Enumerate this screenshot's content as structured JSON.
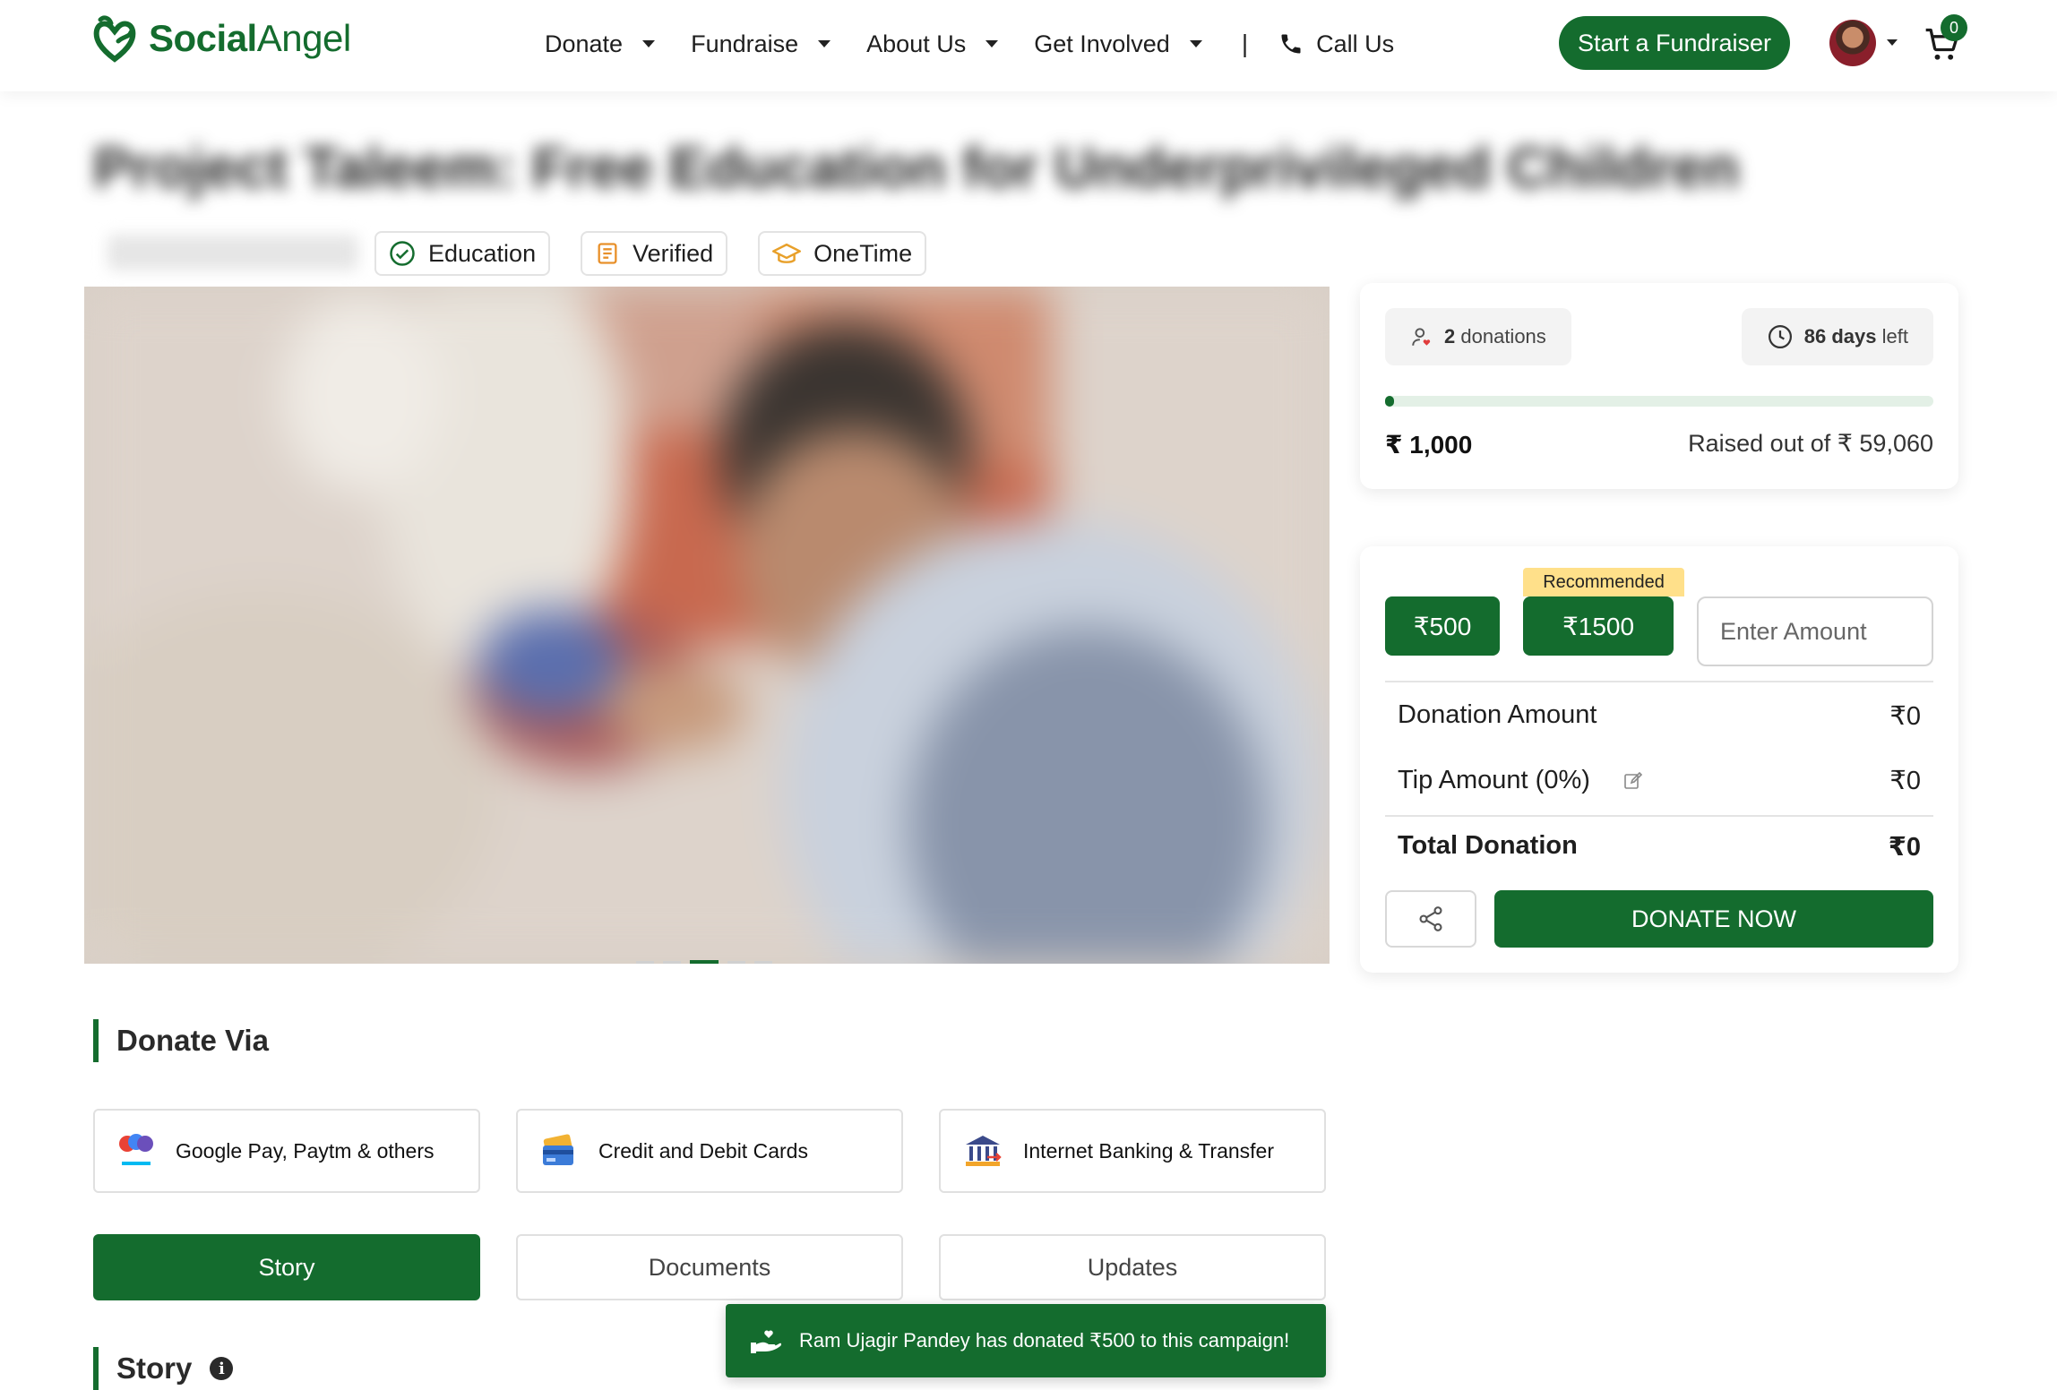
{
  "brand": {
    "logo_part1": "Social",
    "logo_part2": "Angel",
    "color": "#146c2e"
  },
  "nav": {
    "items": [
      {
        "label": "Donate"
      },
      {
        "label": "Fundraise"
      },
      {
        "label": "About Us"
      },
      {
        "label": "Get Involved"
      }
    ],
    "separator": "|",
    "call_label": "Call Us",
    "call_icon": "phone-icon",
    "start_button": "Start a Fundraiser",
    "cart_count": "0",
    "cart_icon": "cart-icon"
  },
  "campaign": {
    "title": "Project Taleem: Free Education for Underprivileged Children",
    "tags": [
      {
        "label": "Education",
        "icon": "check-circle-icon"
      },
      {
        "label": "Verified",
        "icon": "document-icon"
      },
      {
        "label": "OneTime",
        "icon": "graduation-cap-icon"
      }
    ],
    "carousel_active_index": 2
  },
  "stats": {
    "donations_count": "2",
    "donations_label": "donations",
    "days_count": "86 days",
    "days_label": "left",
    "raised": "₹ 1,000",
    "raised_out_of": "Raised out of ₹ 59,060",
    "progress_fraction": 0.017
  },
  "donate": {
    "option_1": "₹500",
    "option_2": "₹1500",
    "recommended_label": "Recommended",
    "amount_placeholder": "Enter Amount",
    "donation_amount_label": "Donation Amount",
    "donation_amount_value": "₹0",
    "tip_label": "Tip Amount (0%)",
    "tip_value": "₹0",
    "total_label": "Total Donation",
    "total_value": "₹0",
    "donate_button": "DONATE NOW"
  },
  "donate_via": {
    "heading": "Donate Via",
    "options": [
      {
        "label": "Google Pay, Paytm & others"
      },
      {
        "label": "Credit and Debit Cards"
      },
      {
        "label": "Internet Banking & Transfer"
      }
    ]
  },
  "tabs": [
    {
      "label": "Story",
      "active": true
    },
    {
      "label": "Documents",
      "active": false
    },
    {
      "label": "Updates",
      "active": false
    }
  ],
  "story": {
    "heading": "Story"
  },
  "toast": {
    "message": "Ram Ujagir Pandey has donated ₹500 to this campaign!"
  }
}
